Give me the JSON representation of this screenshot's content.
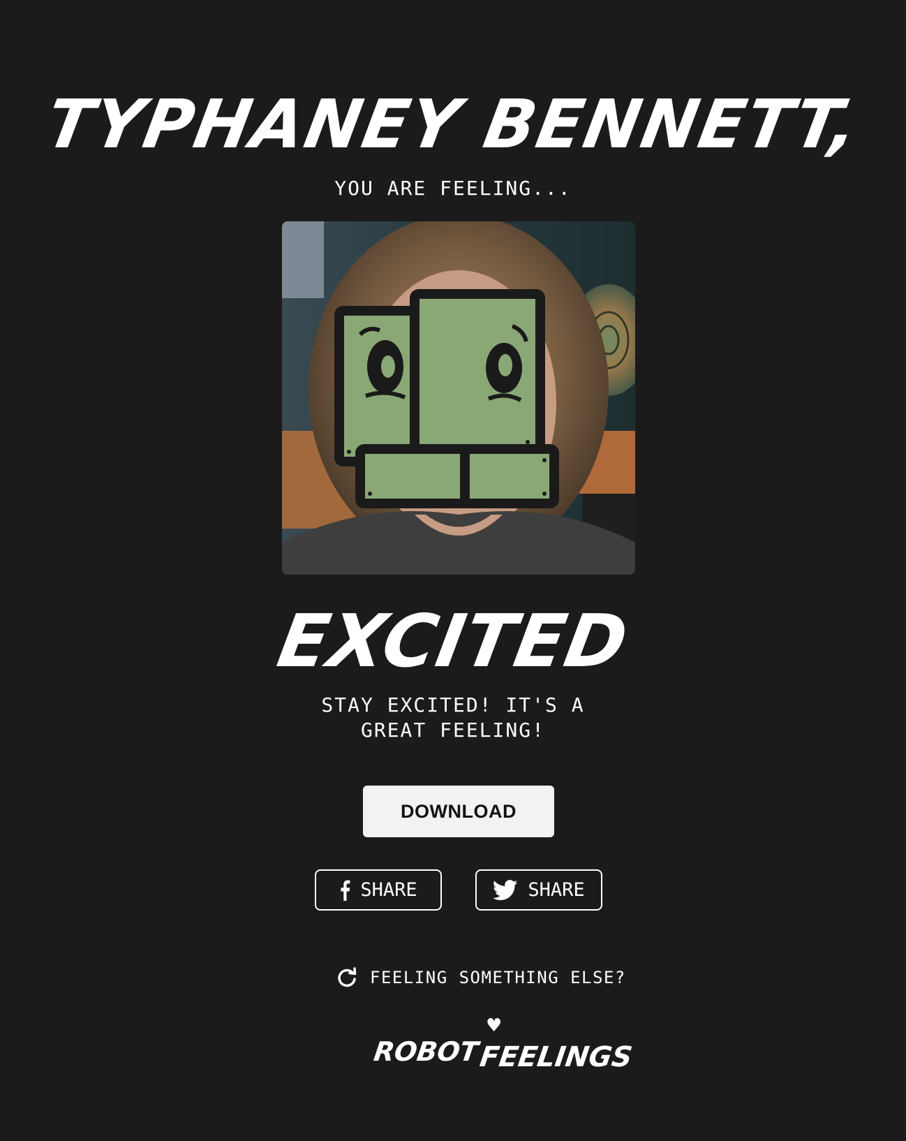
{
  "header": {
    "name": "TYPHANEY BENNETT,",
    "subtitle": "YOU ARE FEELING..."
  },
  "result": {
    "feeling": "EXCITED",
    "message": "STAY EXCITED! IT'S A GREAT FEELING!"
  },
  "actions": {
    "download_label": "DOWNLOAD",
    "facebook_share_label": "SHARE",
    "twitter_share_label": "SHARE",
    "again_label": "FEELING SOMETHING ELSE?"
  },
  "brand": {
    "logo_word1": "ROBOT",
    "logo_word2": "FEELINGS"
  },
  "icons": {
    "facebook": "facebook-icon",
    "twitter": "twitter-icon",
    "refresh": "refresh-icon",
    "heart": "heart-icon"
  },
  "colors": {
    "background": "#1b1b1b",
    "text": "#ffffff",
    "button_bg": "#f1f2f4",
    "robot_green": "#8aa875",
    "robot_outline": "#1a1a1a"
  }
}
